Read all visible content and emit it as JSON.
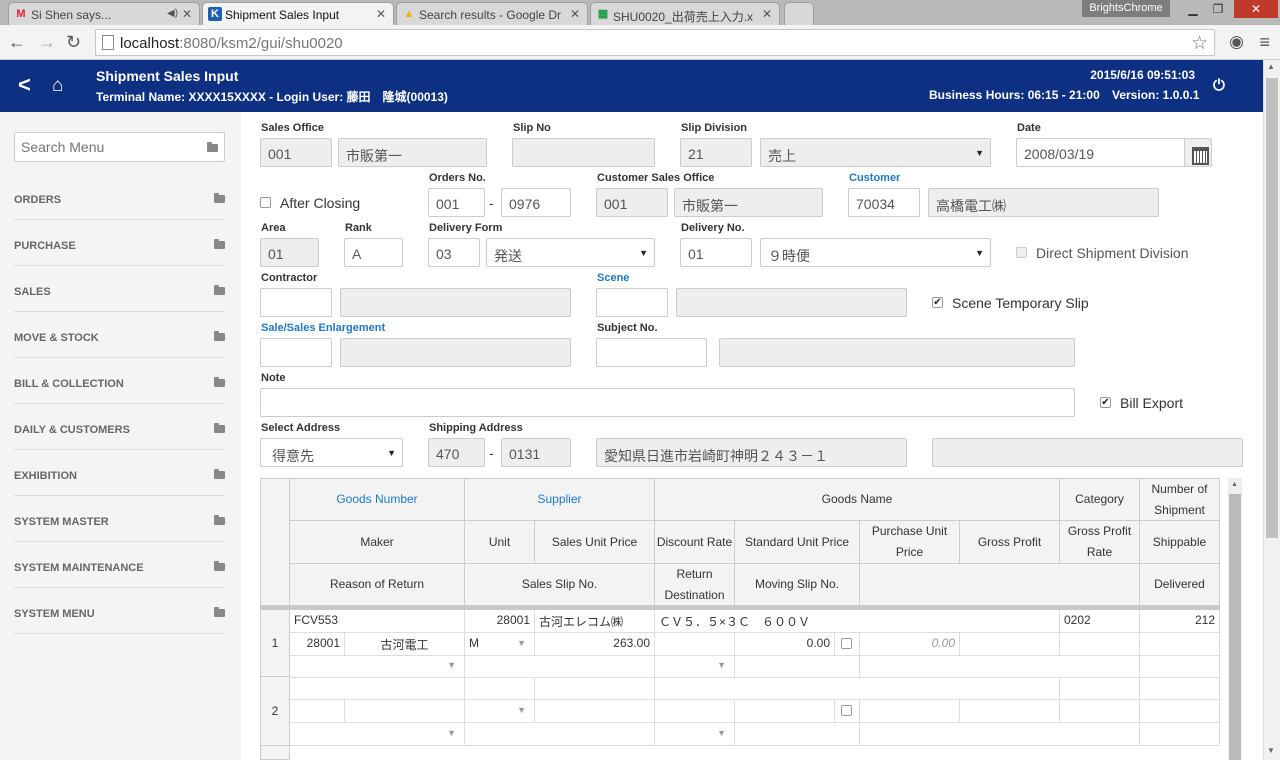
{
  "browser": {
    "tabs": [
      {
        "title": "Si Shen says...",
        "icon": "M"
      },
      {
        "title": "Shipment Sales Input",
        "icon": "K"
      },
      {
        "title": "Search results - Google Dr",
        "icon": "▲"
      },
      {
        "title": "SHU0020_出荷売上入力.x",
        "icon": "▦"
      }
    ],
    "profile": "BrightsChrome",
    "url_host": "localhost",
    "url_path": ":8080/ksm2/gui/shu0020"
  },
  "header": {
    "title": "Shipment Sales Input",
    "subtitle": "Terminal Name: XXXX15XXXX - Login User: 藤田　隆城(00013)",
    "datetime": "2015/6/16 09:51:03",
    "business_hours": "Business Hours: 06:15 - 21:00",
    "version": "Version: 1.0.0.1"
  },
  "sidebar": {
    "search_placeholder": "Search Menu",
    "items": [
      "ORDERS",
      "PURCHASE",
      "SALES",
      "MOVE & STOCK",
      "BILL & COLLECTION",
      "DAILY & CUSTOMERS",
      "EXHIBITION",
      "SYSTEM MASTER",
      "SYSTEM MAINTENANCE",
      "SYSTEM MENU"
    ]
  },
  "form": {
    "sales_office": {
      "label": "Sales Office",
      "code": "001",
      "name": "市販第一"
    },
    "slip_no": {
      "label": "Slip No",
      "value": ""
    },
    "slip_division": {
      "label": "Slip Division",
      "code": "21",
      "name": "売上"
    },
    "date": {
      "label": "Date",
      "value": "2008/03/19"
    },
    "after_closing": {
      "label": "After Closing",
      "checked": false
    },
    "orders_no": {
      "label": "Orders No.",
      "part1": "001",
      "part2": "0976"
    },
    "customer_sales_office": {
      "label": "Customer Sales Office",
      "code": "001",
      "name": "市販第一"
    },
    "customer": {
      "label": "Customer",
      "code": "70034",
      "name": "高橋電工㈱"
    },
    "area": {
      "label": "Area",
      "value": "01"
    },
    "rank": {
      "label": "Rank",
      "value": "A"
    },
    "delivery_form": {
      "label": "Delivery Form",
      "code": "03",
      "name": "発送"
    },
    "delivery_no": {
      "label": "Delivery No.",
      "code": "01",
      "name": "９時便"
    },
    "direct_shipment": {
      "label": "Direct Shipment Division",
      "checked": false
    },
    "contractor": {
      "label": "Contractor",
      "code": "",
      "name": ""
    },
    "scene": {
      "label": "Scene",
      "code": "",
      "name": ""
    },
    "scene_temporary_slip": {
      "label": "Scene Temporary Slip",
      "checked": true
    },
    "sale_enlargement": {
      "label": "Sale/Sales Enlargement",
      "code": "",
      "name": ""
    },
    "subject_no": {
      "label": "Subject No.",
      "code": "",
      "name": ""
    },
    "note": {
      "label": "Note",
      "value": ""
    },
    "bill_export": {
      "label": "Bill Export",
      "checked": true
    },
    "select_address": {
      "label": "Select Address",
      "value": "得意先"
    },
    "shipping_address": {
      "label": "Shipping Address",
      "zip1": "470",
      "zip2": "0131",
      "address1": "愛知県日進市岩崎町神明２４３－１",
      "address2": ""
    }
  },
  "grid": {
    "headers": {
      "goods_number": "Goods Number",
      "supplier": "Supplier",
      "goods_name": "Goods Name",
      "category": "Category",
      "number_of_shipment": "Number of Shipment",
      "maker": "Maker",
      "unit": "Unit",
      "sales_unit_price": "Sales Unit Price",
      "discount_rate": "Discount Rate",
      "standard_unit_price": "Standard Unit Price",
      "purchase_unit_price": "Purchase Unit Price",
      "gross_profit": "Gross Profit",
      "gross_profit_rate": "Gross Profit Rate",
      "shippable": "Shippable",
      "reason_of_return": "Reason of Return",
      "sales_slip_no": "Sales Slip No.",
      "return_destination": "Return Destination",
      "moving_slip_no": "Moving Slip No.",
      "delivered": "Delivered"
    },
    "rows": [
      {
        "num": "1",
        "goods_number": "FCV553",
        "supplier_code": "28001",
        "supplier_name": "古河エレコム㈱",
        "goods_name": "ＣＶ５．５×３Ｃ　６００Ｖ",
        "category": "0202",
        "shipment": "212",
        "maker_code": "28001",
        "maker_name": "古河電工",
        "unit": "M",
        "sales_unit_price": "263.00",
        "standard_unit_price": "0.00",
        "purchase_unit_price": "0.00"
      },
      {
        "num": "2"
      }
    ]
  }
}
